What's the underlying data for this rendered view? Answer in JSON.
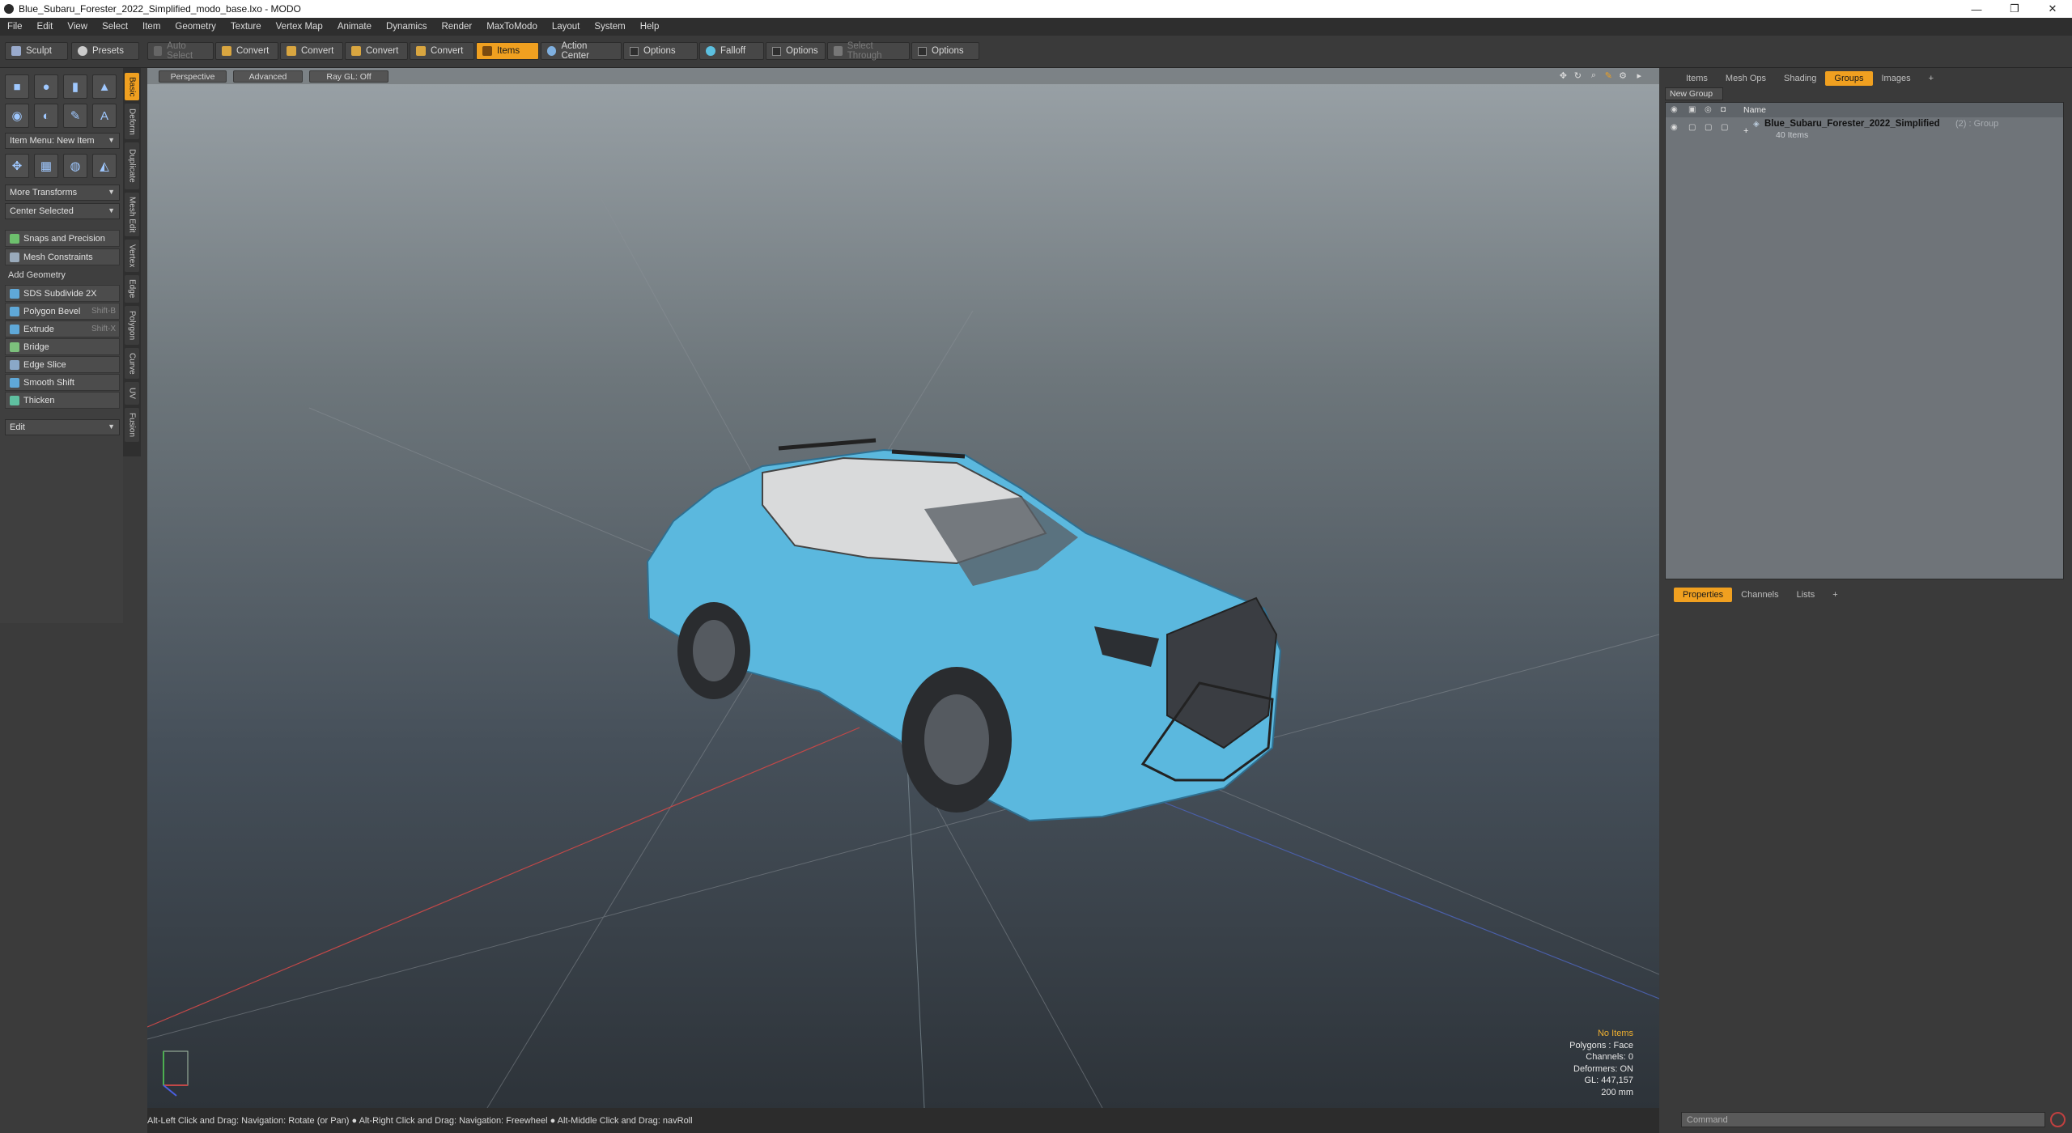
{
  "window": {
    "title": "Blue_Subaru_Forester_2022_Simplified_modo_base.lxo - MODO",
    "minimize": "—",
    "restore": "❐",
    "close": "✕"
  },
  "menu": [
    "File",
    "Edit",
    "View",
    "Select",
    "Item",
    "Geometry",
    "Texture",
    "Vertex Map",
    "Animate",
    "Dynamics",
    "Render",
    "MaxToModo",
    "Layout",
    "System",
    "Help"
  ],
  "toolbar": {
    "sculpt": "Sculpt",
    "presets": "Presets",
    "auto_select": "Auto Select",
    "convert1": "Convert",
    "convert2": "Convert",
    "convert3": "Convert",
    "convert4": "Convert",
    "items": "Items",
    "action_center": "Action Center",
    "options1": "Options",
    "falloff": "Falloff",
    "options2": "Options",
    "select_through": "Select Through",
    "options3": "Options"
  },
  "left": {
    "vtabs": [
      "Basic",
      "Deform",
      "Duplicate",
      "Mesh Edit",
      "Vertex",
      "Edge",
      "Polygon",
      "Curve",
      "UV",
      "Fusion"
    ],
    "item_menu": "Item Menu: New Item",
    "more_transforms": "More Transforms",
    "center_selected": "Center Selected",
    "snaps": "Snaps and Precision",
    "mesh_constraints": "Mesh Constraints",
    "add_geometry": "Add Geometry",
    "tools": [
      {
        "label": "SDS Subdivide 2X",
        "shortcut": ""
      },
      {
        "label": "Polygon Bevel",
        "shortcut": "Shift-B"
      },
      {
        "label": "Extrude",
        "shortcut": "Shift-X"
      },
      {
        "label": "Bridge",
        "shortcut": ""
      },
      {
        "label": "Edge Slice",
        "shortcut": ""
      },
      {
        "label": "Smooth Shift",
        "shortcut": ""
      },
      {
        "label": "Thicken",
        "shortcut": ""
      }
    ],
    "edit": "Edit"
  },
  "viewport": {
    "perspective": "Perspective",
    "advanced": "Advanced",
    "raygl": "Ray GL: Off",
    "info": {
      "items": "No Items",
      "polygons": "Polygons : Face",
      "channels": "Channels: 0",
      "deformers": "Deformers: ON",
      "gl": "GL: 447,157",
      "scale": "200 mm"
    }
  },
  "status": "Alt-Left Click and Drag: Navigation: Rotate (or Pan) ● Alt-Right Click and Drag: Navigation: Freewheel ● Alt-Middle Click and Drag: navRoll",
  "right": {
    "tabs": [
      "Items",
      "Mesh Ops",
      "Shading",
      "Groups",
      "Images",
      "+"
    ],
    "new_group": "New Group",
    "col_name": "Name",
    "group_name": "Blue_Subaru_Forester_2022_Simplified",
    "group_suffix": "(2) : Group",
    "group_items": "40 Items",
    "bottom_tabs": [
      "Properties",
      "Channels",
      "Lists",
      "+"
    ],
    "command_placeholder": "Command"
  },
  "colors": {
    "accent": "#f0a020",
    "car": "#5bb8de"
  }
}
